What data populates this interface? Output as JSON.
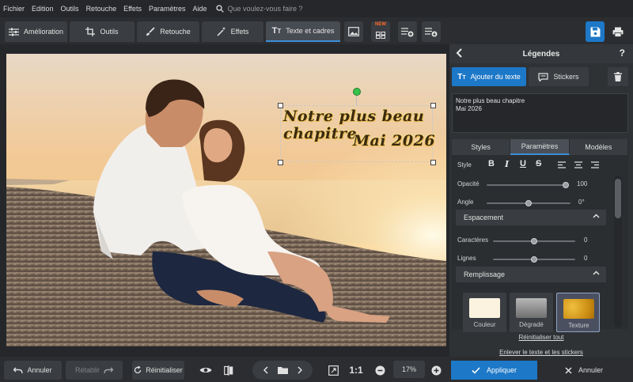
{
  "menu": {
    "items": [
      "Fichier",
      "Edition",
      "Outils",
      "Retouche",
      "Effets",
      "Paramètres",
      "Aide"
    ],
    "search_placeholder": "Que voulez-vous faire ?"
  },
  "toolbar": {
    "tabs": [
      {
        "label": "Amélioration",
        "icon": "sliders-icon"
      },
      {
        "label": "Outils",
        "icon": "crop-icon"
      },
      {
        "label": "Retouche",
        "icon": "brush-icon"
      },
      {
        "label": "Effets",
        "icon": "magic-wand-icon"
      },
      {
        "label": "Texte et cadres",
        "icon": "text-icon",
        "active": true
      }
    ],
    "new_badge": "NEW"
  },
  "canvas": {
    "caption_line1": "Notre plus beau chapitre",
    "caption_line2": "Mai 2026"
  },
  "panel": {
    "title": "Légendes",
    "add_text_label": "Ajouter du texte",
    "stickers_label": "Stickers",
    "text_value_line1": "Notre plus beau chapitre",
    "text_value_line2": "Mai 2026",
    "subtabs": [
      "Styles",
      "Paramètres",
      "Modèles"
    ],
    "active_subtab": "Paramètres",
    "style_label": "Style",
    "style_buttons": [
      "B",
      "I",
      "U",
      "S"
    ],
    "opacity_label": "Opacité",
    "opacity_value": "100",
    "opacity_level": 1.0,
    "angle_label": "Angle",
    "angle_value": "0°",
    "angle_level": 0.5,
    "spacing_section": "Espacement",
    "chars_label": "Caractères",
    "chars_value": "0",
    "chars_level": 0.5,
    "lines_label": "Lignes",
    "lines_value": "0",
    "lines_level": 0.5,
    "fill_section": "Remplissage",
    "fill_options": [
      {
        "label": "Couleur",
        "color": "#fbf3e0"
      },
      {
        "label": "Dégradé",
        "color": "#8a8a8a"
      },
      {
        "label": "Texture",
        "color": "#d9a21e",
        "selected": true
      }
    ],
    "reset_all_label": "Réinitialiser tout",
    "remove_label": "Enlever le texte et les stickers"
  },
  "bottom": {
    "undo_label": "Annuler",
    "redo_label": "Rétablir",
    "reset_label": "Réinitialiser",
    "one_to_one": "1:1",
    "zoom_value": "17%",
    "apply_label": "Appliquer",
    "cancel_label": "Annuler"
  },
  "colors": {
    "accent": "#1d78c8",
    "rotate_handle": "#38c24a"
  }
}
